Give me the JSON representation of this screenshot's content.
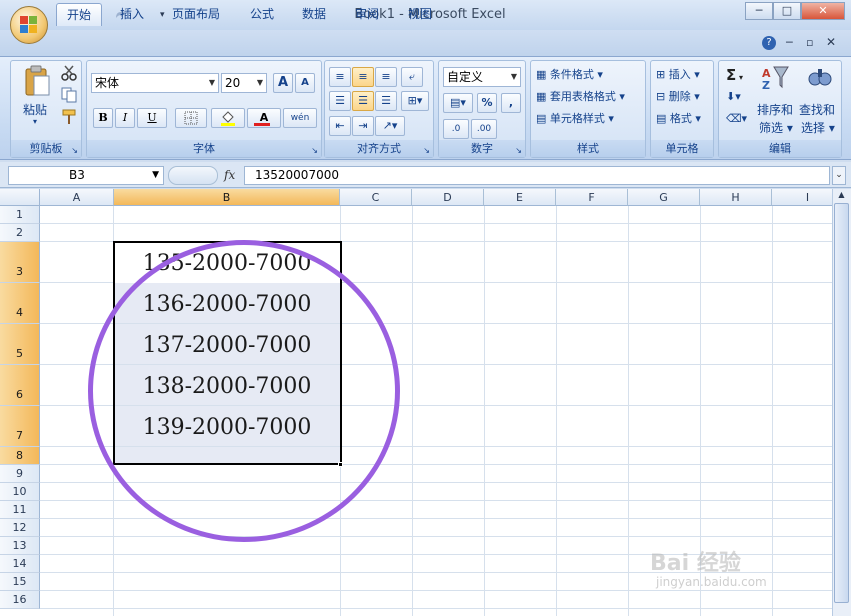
{
  "window": {
    "title": "Book1 - Microsoft Excel",
    "min": "─",
    "max": "□",
    "close": "✕"
  },
  "tabs": [
    "开始",
    "插入",
    "页面布局",
    "公式",
    "数据",
    "审阅",
    "视图"
  ],
  "ribbon": {
    "clipboard": {
      "paste": "粘贴",
      "label": "剪贴板"
    },
    "font": {
      "name": "宋体",
      "size": "20",
      "bold": "B",
      "italic": "I",
      "underline": "U",
      "label": "字体",
      "grow": "A",
      "shrink": "A",
      "color_a": "A",
      "phonetic": "wén"
    },
    "alignment": {
      "label": "对齐方式"
    },
    "number": {
      "format": "自定义",
      "percent": "%",
      "comma": ",",
      "label": "数字",
      "inc": ".0",
      "dec": ".00"
    },
    "styles": {
      "conditional": "条件格式",
      "table": "套用表格格式",
      "cell": "单元格样式",
      "label": "样式"
    },
    "cells": {
      "insert": "插入",
      "delete": "删除",
      "format": "格式",
      "label": "单元格"
    },
    "editing": {
      "sigma": "Σ",
      "sort": "排序和",
      "sort2": "筛选",
      "find": "查找和",
      "find2": "选择",
      "label": "编辑"
    }
  },
  "formula_bar": {
    "name_box": "B3",
    "fx": "fx",
    "value": "13520007000"
  },
  "columns": [
    "A",
    "B",
    "C",
    "D",
    "E",
    "F",
    "G",
    "H",
    "I"
  ],
  "rows": [
    "1",
    "2",
    "3",
    "4",
    "5",
    "6",
    "7",
    "8",
    "9",
    "10",
    "11",
    "12",
    "13",
    "14",
    "15",
    "16"
  ],
  "cells": [
    "135-2000-7000",
    "136-2000-7000",
    "137-2000-7000",
    "138-2000-7000",
    "139-2000-7000"
  ],
  "watermark": {
    "main": "Bai 经验",
    "sub": "jingyan.baidu.com"
  },
  "colors": {
    "accent": "#9a5fe0",
    "selection_header": "#f3b85a"
  }
}
